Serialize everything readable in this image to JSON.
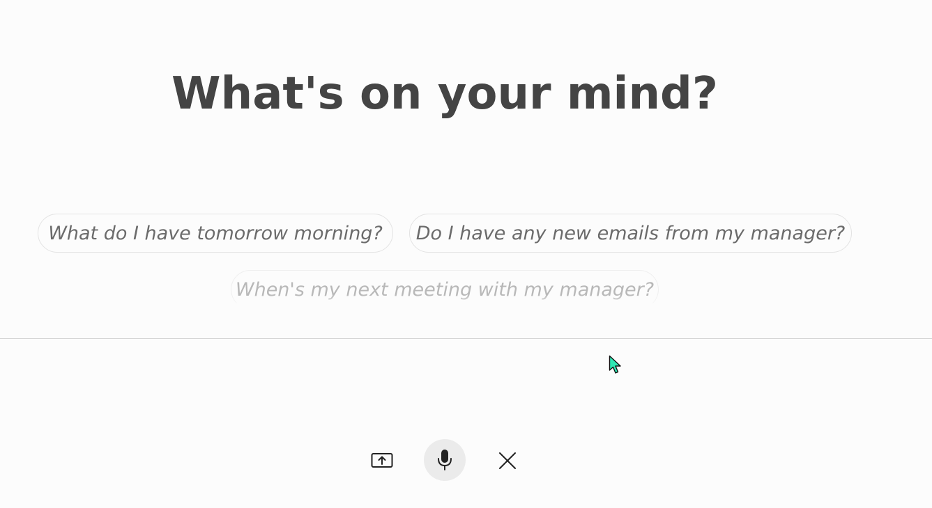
{
  "main": {
    "headline": "What's on your mind?",
    "suggestions": [
      {
        "label": "What do I have tomorrow morning?"
      },
      {
        "label": "Do I have any new emails from my manager?"
      },
      {
        "label": "When's my next meeting with my manager?"
      }
    ]
  },
  "toolbar": {
    "upload_icon": "screen-share-icon",
    "mic_icon": "microphone-icon",
    "close_icon": "close-icon"
  },
  "colors": {
    "background": "#fcfcfc",
    "headline": "#444444",
    "chip_text": "#6b6b6b",
    "chip_border": "#e3e3e3",
    "mic_bg": "#ebebeb",
    "cursor": "#2ee8b4"
  }
}
